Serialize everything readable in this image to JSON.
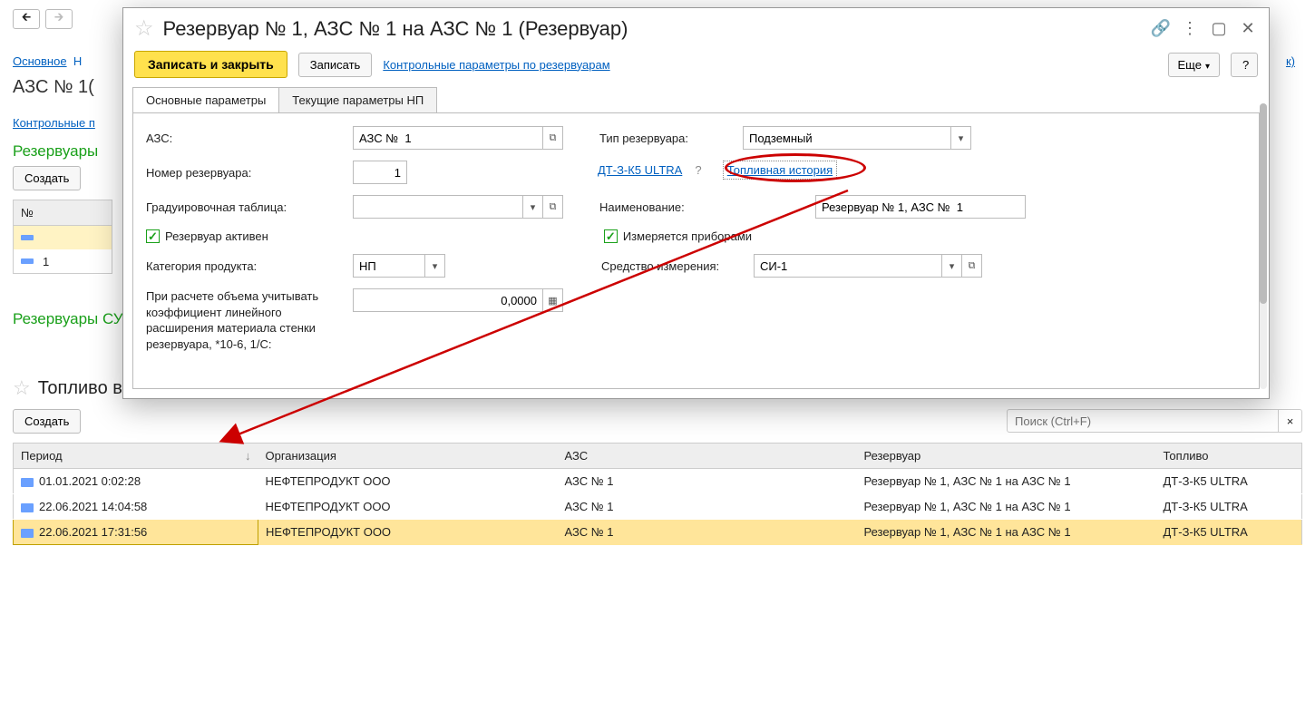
{
  "bg": {
    "osnovnoe": "Основное",
    "title": "АЗС №  1(",
    "control_link": "Контрольные п",
    "section1": "Резервуары",
    "create": "Создать",
    "col_num": "№",
    "row2_num": "1",
    "section2": "Резервуары СУГ"
  },
  "dialog": {
    "title": "Резервуар № 1, АЗС №  1 на АЗС №  1 (Резервуар)",
    "save_close": "Записать и закрыть",
    "save": "Записать",
    "control_link": "Контрольные параметры по резервуарам",
    "more": "Еще",
    "help": "?",
    "tabs": {
      "main": "Основные параметры",
      "current": "Текущие параметры НП"
    },
    "form": {
      "azs_lbl": "АЗС:",
      "azs_val": "АЗС №  1",
      "type_lbl": "Тип резервуара:",
      "type_val": "Подземный",
      "num_lbl": "Номер резервуара:",
      "num_val": "1",
      "fuel_link": "ДТ-З-К5 ULTRA",
      "q": "?",
      "history_link": "Топливная история",
      "grad_lbl": "Градуировочная таблица:",
      "grad_val": "",
      "name_lbl": "Наименование:",
      "name_val": "Резервуар № 1, АЗС №  1",
      "active_lbl": "Резервуар активен",
      "measured_lbl": "Измеряется приборами",
      "cat_lbl": "Категория продукта:",
      "cat_val": "НП",
      "si_lbl": "Средство измерения:",
      "si_val": "СИ-1",
      "coeff_lbl": "При расчете объема учитывать коэффициент линейного расширения материала стенки резервуара, *10-6, 1/С:",
      "coeff_val": "0,0000"
    }
  },
  "bottom": {
    "title": "Топливо в резервуарах",
    "create": "Создать",
    "search_ph": "Поиск (Ctrl+F)",
    "cols": {
      "period": "Период",
      "org": "Организация",
      "azs": "АЗС",
      "res": "Резервуар",
      "fuel": "Топливо"
    },
    "rows": [
      {
        "period": "01.01.2021 0:02:28",
        "org": "НЕФТЕПРОДУКТ ООО",
        "azs": "АЗС №  1",
        "res": "Резервуар № 1, АЗС №  1 на АЗС №  1",
        "fuel": "ДТ-З-К5 ULTRA"
      },
      {
        "period": "22.06.2021 14:04:58",
        "org": "НЕФТЕПРОДУКТ ООО",
        "azs": "АЗС №  1",
        "res": "Резервуар № 1, АЗС №  1 на АЗС №  1",
        "fuel": "ДТ-З-К5 ULTRA"
      },
      {
        "period": "22.06.2021 17:31:56",
        "org": "НЕФТЕПРОДУКТ ООО",
        "azs": "АЗС №  1",
        "res": "Резервуар № 1, АЗС №  1 на АЗС №  1",
        "fuel": "ДТ-З-К5 ULTRA"
      }
    ]
  }
}
